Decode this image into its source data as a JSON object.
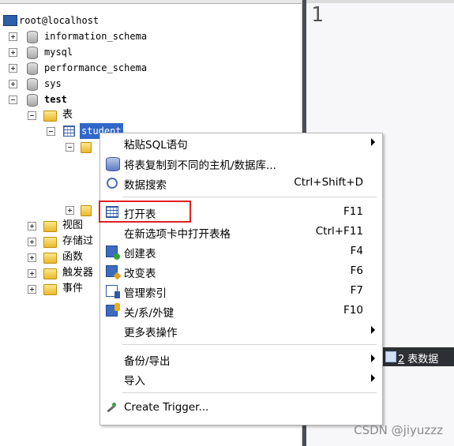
{
  "tree": {
    "root": "root@localhost",
    "databases": [
      {
        "name": "information_schema"
      },
      {
        "name": "mysql"
      },
      {
        "name": "performance_schema"
      },
      {
        "name": "sys"
      },
      {
        "name": "test"
      }
    ],
    "tables_folder": "表",
    "selected_table": "student",
    "other_folders": [
      "视图",
      "存储过",
      "函数",
      "触发器",
      "事件"
    ]
  },
  "editor": {
    "line_number": "1"
  },
  "result_tab": {
    "number": "2",
    "label": "表数据"
  },
  "context_menu": {
    "items": [
      {
        "label": "粘贴SQL语句",
        "shortcut": "",
        "submenu": true,
        "icon": "none"
      },
      {
        "label": "将表复制到不同的主机/数据库...",
        "shortcut": "",
        "submenu": false,
        "icon": "database-copy-icon"
      },
      {
        "label": "数据搜索",
        "shortcut": "Ctrl+Shift+D",
        "submenu": false,
        "icon": "search-icon"
      },
      {
        "label": "打开表",
        "shortcut": "F11",
        "submenu": false,
        "icon": "table-icon"
      },
      {
        "label": "在新选项卡中打开表格",
        "shortcut": "Ctrl+F11",
        "submenu": false,
        "icon": "none"
      },
      {
        "label": "创建表",
        "shortcut": "F4",
        "submenu": false,
        "icon": "create-table-icon"
      },
      {
        "label": "改变表",
        "shortcut": "F6",
        "submenu": false,
        "icon": "alter-table-icon"
      },
      {
        "label": "管理索引",
        "shortcut": "F7",
        "submenu": false,
        "icon": "index-icon"
      },
      {
        "label": "关/系/外键",
        "shortcut": "F10",
        "submenu": false,
        "icon": "foreign-key-icon"
      },
      {
        "label": "更多表操作",
        "shortcut": "",
        "submenu": true,
        "icon": "none"
      },
      {
        "label": "备份/导出",
        "shortcut": "",
        "submenu": true,
        "icon": "none"
      },
      {
        "label": "导入",
        "shortcut": "",
        "submenu": true,
        "icon": "none"
      },
      {
        "label": "Create Trigger...",
        "shortcut": "",
        "submenu": false,
        "icon": "trigger-icon"
      }
    ]
  },
  "watermark": "CSDN @jiyuzzz",
  "colors": {
    "selection": "#3167c9",
    "highlight_box": "#e02020",
    "splitter": "#4a4d53"
  }
}
